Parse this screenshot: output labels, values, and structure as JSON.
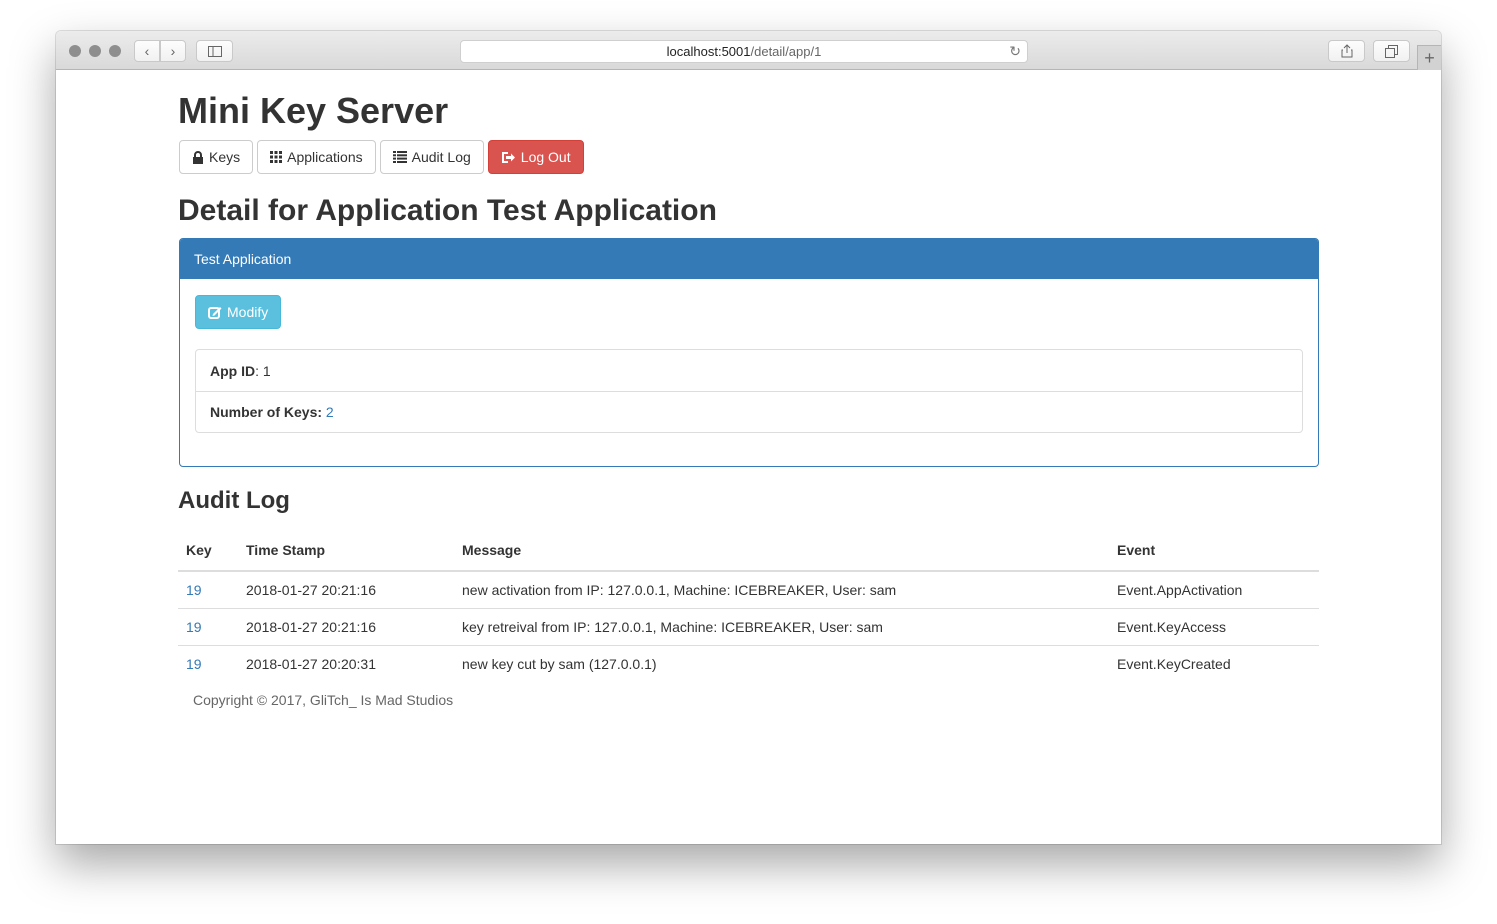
{
  "browser": {
    "url_host": "localhost:5001",
    "url_path": "/detail/app/1"
  },
  "site": {
    "title": "Mini Key Server"
  },
  "nav": {
    "keys": "Keys",
    "applications": "Applications",
    "audit_log": "Audit Log",
    "log_out": "Log Out"
  },
  "page": {
    "title": "Detail for Application Test Application"
  },
  "panel": {
    "heading": "Test Application",
    "modify_label": "Modify",
    "app_id_label": "App ID",
    "app_id_value": "1",
    "num_keys_label": "Number of Keys:",
    "num_keys_value": "2"
  },
  "audit": {
    "title": "Audit Log",
    "columns": [
      "Key",
      "Time Stamp",
      "Message",
      "Event"
    ],
    "rows": [
      {
        "key": "19",
        "timestamp": "2018-01-27 20:21:16",
        "message": "new activation from IP: 127.0.0.1, Machine: ICEBREAKER, User: sam",
        "event": "Event.AppActivation"
      },
      {
        "key": "19",
        "timestamp": "2018-01-27 20:21:16",
        "message": "key retreival from IP: 127.0.0.1, Machine: ICEBREAKER, User: sam",
        "event": "Event.KeyAccess"
      },
      {
        "key": "19",
        "timestamp": "2018-01-27 20:20:31",
        "message": "new key cut by sam (127.0.0.1)",
        "event": "Event.KeyCreated"
      }
    ]
  },
  "footer": {
    "text": "Copyright © 2017, GliTch_ Is Mad Studios"
  },
  "colors": {
    "primary": "#337ab7",
    "danger": "#d9534f",
    "info": "#5bc0de"
  }
}
